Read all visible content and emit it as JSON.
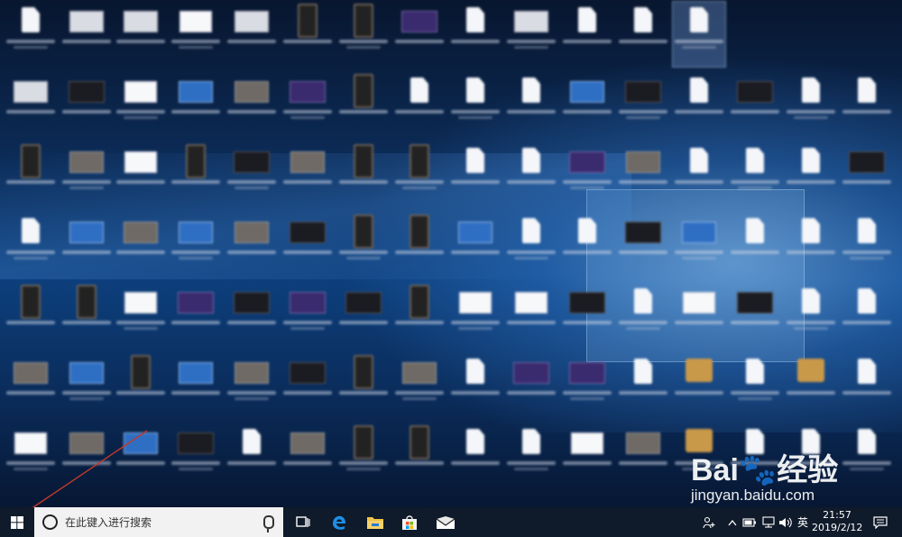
{
  "desktop": {
    "icon_types": [
      [
        "doc",
        "wide",
        "wide",
        "white",
        "wide",
        "phone",
        "phone",
        "purple",
        "doc",
        "wide",
        "doc",
        "doc",
        "doc"
      ],
      [
        "wide",
        "dark",
        "white",
        "blue",
        "gray",
        "purple",
        "phone",
        "doc",
        "doc",
        "doc",
        "blue",
        "dark",
        "doc",
        "dark",
        "doc",
        "doc"
      ],
      [
        "phone",
        "gray",
        "white",
        "phone",
        "dark",
        "gray",
        "phone",
        "phone",
        "doc",
        "doc",
        "purple",
        "gray",
        "doc",
        "doc",
        "doc",
        "dark"
      ],
      [
        "doc",
        "blue",
        "gray",
        "blue",
        "gray",
        "dark",
        "phone",
        "phone",
        "blue",
        "doc",
        "doc",
        "dark",
        "blue",
        "doc",
        "doc",
        "doc"
      ],
      [
        "phone",
        "phone",
        "white",
        "purple",
        "dark",
        "purple",
        "dark",
        "phone",
        "white",
        "white",
        "dark",
        "doc",
        "white",
        "dark",
        "doc",
        "doc"
      ],
      [
        "gray",
        "blue",
        "phone",
        "blue",
        "gray",
        "dark",
        "phone",
        "gray",
        "doc",
        "purple",
        "purple",
        "doc",
        "box",
        "doc",
        "box",
        "doc"
      ],
      [
        "white",
        "gray",
        "blue",
        "dark",
        "doc",
        "gray",
        "phone",
        "phone",
        "doc",
        "doc",
        "white",
        "gray",
        "box",
        "doc",
        "doc",
        "doc"
      ]
    ],
    "selected_icon": "row0-col12"
  },
  "watermark": {
    "logo": "Bai🐾经验",
    "url": "jingyan.baidu.com"
  },
  "taskbar": {
    "search_placeholder": "在此键入进行搜索",
    "pinned": [
      "task-view-icon",
      "edge-icon",
      "file-explorer-icon",
      "store-icon",
      "mail-icon"
    ],
    "tray": {
      "ime": "英",
      "time": "21:57",
      "date": "2019/2/12"
    }
  },
  "colors": {
    "taskbar": "#0f1a2a",
    "search_bg": "#f2f2f2",
    "desktop_blue": "#0d3f7c",
    "arrow": "#c0392b"
  }
}
